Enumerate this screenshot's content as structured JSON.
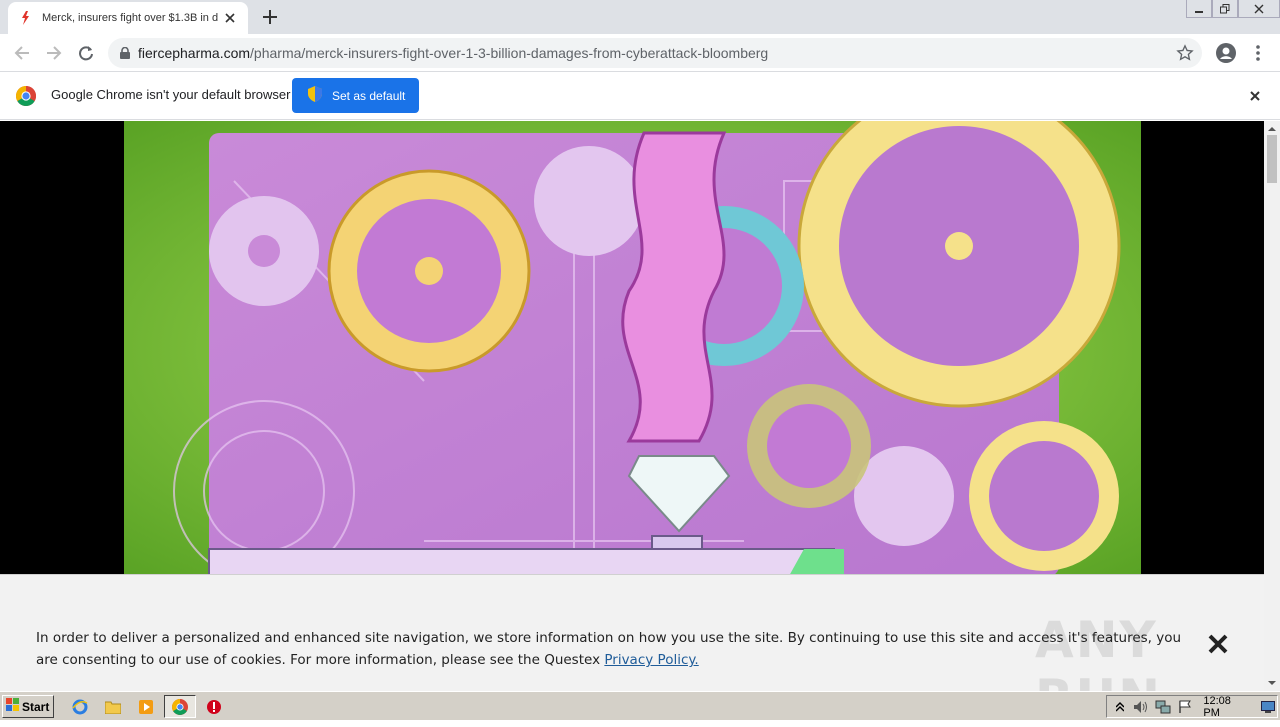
{
  "browser": {
    "tab": {
      "title": "Merck, insurers fight over $1.3B in d",
      "favicon": "fiercepharma-icon"
    },
    "omnibox": {
      "host": "fiercepharma.com",
      "path": "/pharma/merck-insurers-fight-over-1-3-billion-damages-from-cyberattack-bloomberg"
    },
    "infobar": {
      "message": "Google Chrome isn't your default browser",
      "button_label": "Set as default"
    }
  },
  "page": {
    "video_frame": "animated gears and diamond illustration"
  },
  "cookie_banner": {
    "text": "In order to deliver a personalized and enhanced site navigation, we store information on how you use the site. By continuing to use this site and access it's features, you are consenting to our use of cookies. For more information, please see the Questex ",
    "link_label": "Privacy Policy."
  },
  "watermark": "ANY RUN",
  "taskbar": {
    "start_label": "Start",
    "clock": "12:08 PM"
  },
  "colors": {
    "accent": "#1a73e8",
    "tab_strip": "#dee1e6",
    "video_frame_green": "#7ec43a",
    "video_bg_purple": "#c67fd6"
  }
}
